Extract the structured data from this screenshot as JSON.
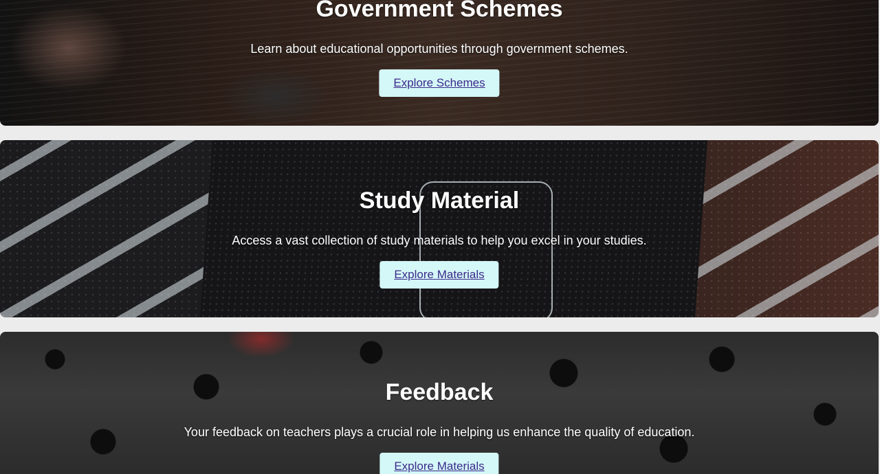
{
  "sections": [
    {
      "title": "Government Schemes",
      "description": "Learn about educational opportunities through government schemes.",
      "button_label": "Explore Schemes"
    },
    {
      "title": "Study Material",
      "description": "Access a vast collection of study materials to help you excel in your studies.",
      "button_label": "Explore Materials"
    },
    {
      "title": "Feedback",
      "description": "Your feedback on teachers plays a crucial role in helping us enhance the quality of education.",
      "button_label": "Explore Materials"
    }
  ],
  "colors": {
    "button_background": "#d4f7f7",
    "button_text": "#3b2a8a",
    "page_background": "#ececec",
    "heading_text": "#ffffff"
  }
}
